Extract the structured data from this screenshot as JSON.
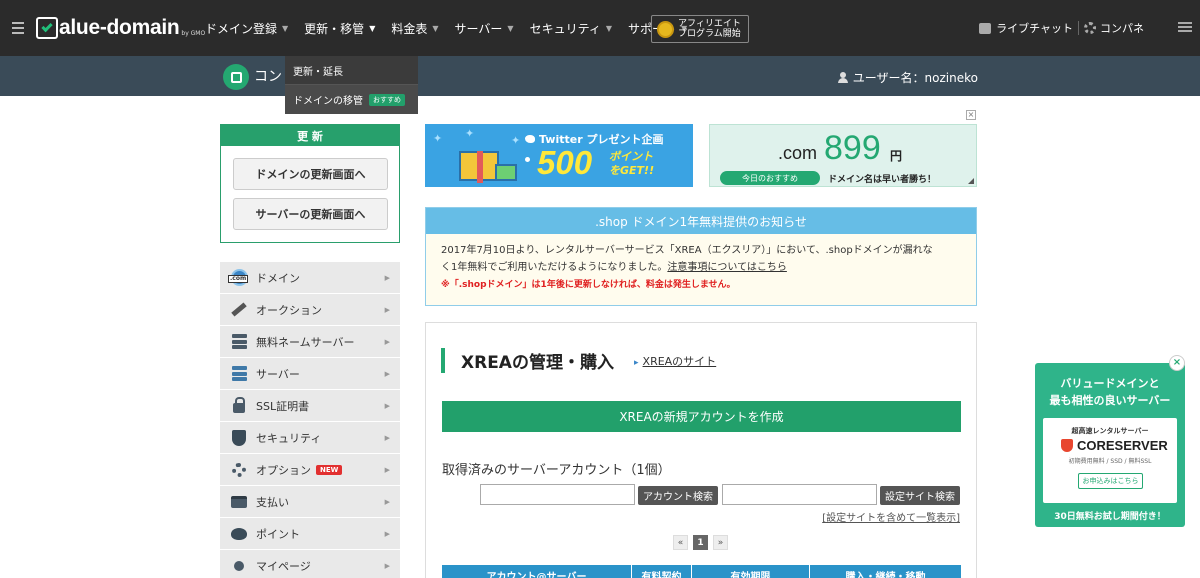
{
  "nav": {
    "logo": "alue-domain",
    "logo_sub": "by GMO",
    "items": [
      {
        "label": "ドメイン登録"
      },
      {
        "label": "更新・移管"
      },
      {
        "label": "料金表"
      },
      {
        "label": "サーバー"
      },
      {
        "label": "セキュリティ"
      },
      {
        "label": "サポート"
      }
    ],
    "affiliate_line1": "アフィリエイト",
    "affiliate_line2": "プログラム開始",
    "livechat": "ライブチャット",
    "control_panel": "コンパネ"
  },
  "subheader": {
    "cp_label": "コント",
    "username": "ユーザー名：nozineko"
  },
  "dropdown": {
    "items": [
      {
        "label": "更新・延長"
      },
      {
        "label": "ドメインの移管",
        "badge": "おすすめ"
      }
    ]
  },
  "renew": {
    "title": "更 新",
    "domain_btn": "ドメインの更新画面へ",
    "server_btn": "サーバーの更新画面へ"
  },
  "sidebar": {
    "items": [
      {
        "label": "ドメイン",
        "icon": "globe-icon"
      },
      {
        "label": "オークション",
        "icon": "gavel-icon"
      },
      {
        "label": "無料ネームサーバー",
        "icon": "server-icon"
      },
      {
        "label": "サーバー",
        "icon": "server-icon"
      },
      {
        "label": "SSL証明書",
        "icon": "lock-icon"
      },
      {
        "label": "セキュリティ",
        "icon": "shield-icon"
      },
      {
        "label": "オプション",
        "icon": "gear-icon",
        "badge": "NEW"
      },
      {
        "label": "支払い",
        "icon": "card-icon"
      },
      {
        "label": "ポイント",
        "icon": "piggy-bank-icon"
      },
      {
        "label": "マイページ",
        "icon": "person-icon"
      }
    ]
  },
  "banner_twitter": {
    "title": "Twitter プレゼント企画",
    "points": "500",
    "points_line1": "ポイント",
    "points_line2": "をGET!!"
  },
  "banner_com": {
    "tld": ".com",
    "price": "899",
    "unit": "円",
    "pill": "今日のおすすめ",
    "slogan": "ドメイン名は早い者勝ち！"
  },
  "notice": {
    "title": ".shop ドメイン1年無料提供のお知らせ",
    "body1": "2017年7月10日より、レンタルサーバーサービス「XREA（エクスリア）」において、.shopドメインが漏れな",
    "body2": "く1年無料でご利用いただけるようになりました。",
    "link": "注意事項についてはこちら",
    "warning": "※「.shopドメイン」は1年後に更新しなければ、料金は発生しません。"
  },
  "xrea": {
    "title": "XREAの管理・購入",
    "site_link": "XREAのサイト",
    "create_btn": "XREAの新規アカウントを作成",
    "accounts_heading": "取得済みのサーバーアカウント（1個）",
    "account_search_btn": "アカウント検索",
    "site_search_btn": "設定サイト検索",
    "list_all": "[設定サイトを含めて一覧表示]",
    "pager_prev": "«",
    "pager_current": "1",
    "pager_next": "»",
    "columns": [
      "アカウント@サーバー",
      "有料契約",
      "有効期限",
      "購入・継続・移動"
    ]
  },
  "sidead": {
    "title_line1": "バリュードメインと",
    "title_line2": "最も相性の良いサーバー",
    "tagline": "超高速レンタルサーバー",
    "brand": "CORESERVER",
    "sub": "初期費用無料 / SSD / 無料SSL",
    "apply_btn": "お申込みはこちら",
    "footer": "30日無料お試し期間付き！",
    "close": "×"
  },
  "colors": {
    "nav_bg": "#2b2b2b",
    "subheader_bg": "#3a4b58",
    "accent_green": "#22a06b",
    "notice_blue": "#66bde6",
    "table_head_blue": "#2a93c9"
  }
}
